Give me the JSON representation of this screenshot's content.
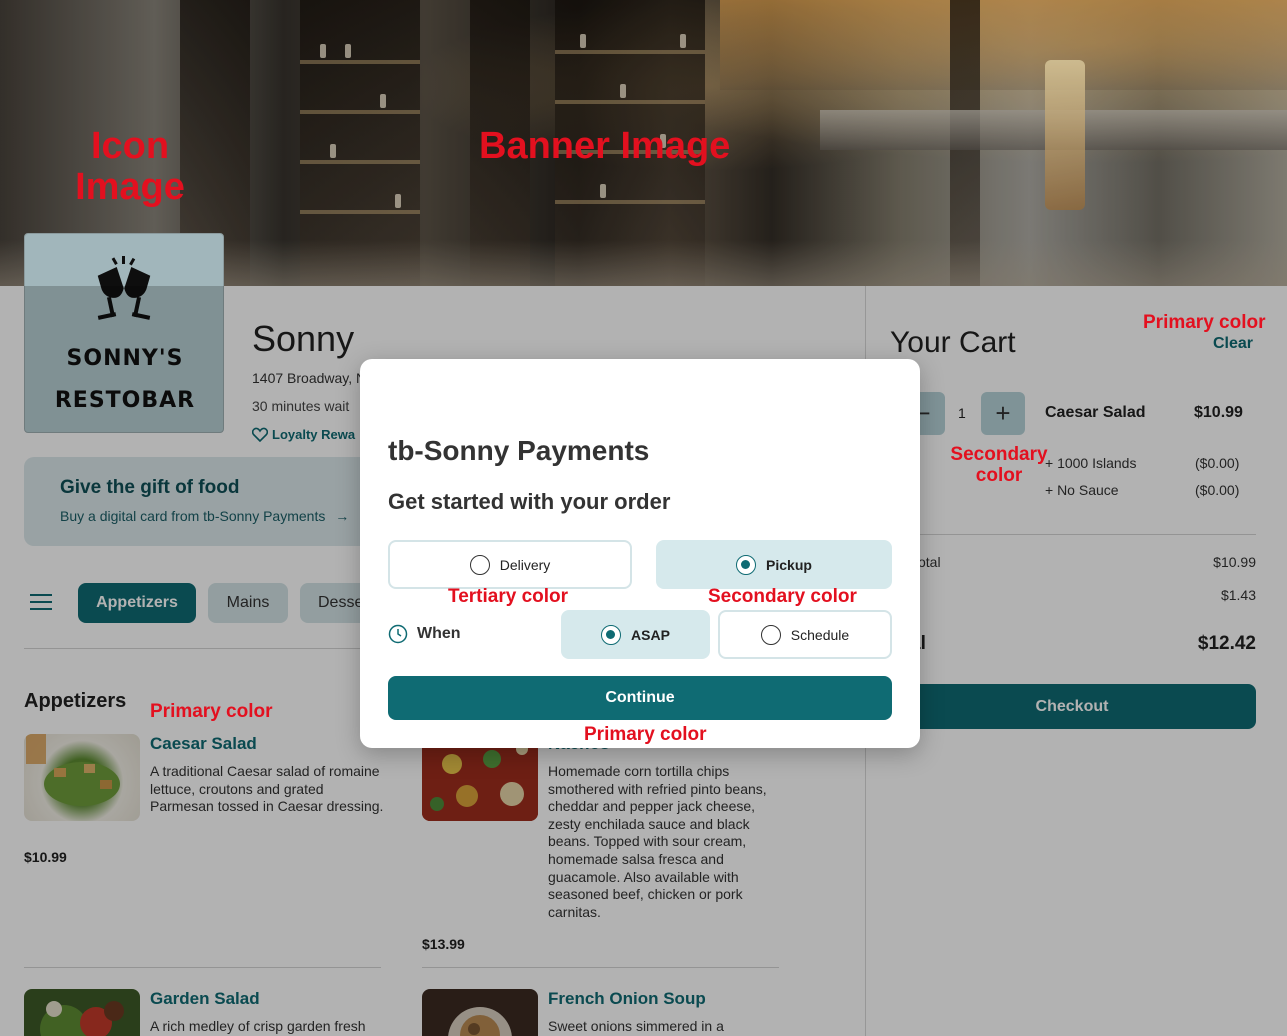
{
  "banner": {
    "annotation_banner": "Banner Image",
    "annotation_icon_line1": "Icon",
    "annotation_icon_line2": "Image"
  },
  "restaurant": {
    "logo_line1": "SONNY'S",
    "logo_line2": "RESTOBAR",
    "name": "Sonny",
    "address": "1407 Broadway, N",
    "wait": "30 minutes wait",
    "loyalty": "Loyalty Rewa"
  },
  "gift": {
    "title": "Give the gift of food",
    "subtitle": "Buy a digital card from tb-Sonny Payments",
    "arrow": "→"
  },
  "tabs": [
    {
      "label": "Appetizers",
      "active": true
    },
    {
      "label": "Mains",
      "active": false
    },
    {
      "label": "Desse",
      "active": false
    }
  ],
  "menu": {
    "section_title": "Appetizers",
    "items": [
      {
        "name": "Caesar Salad",
        "desc": "A traditional Caesar salad of romaine lettuce, croutons and grated Parmesan tossed in Caesar dressing.",
        "price": "$10.99"
      },
      {
        "name": "Nachos",
        "desc": "Homemade corn tortilla chips smothered with refried pinto beans, cheddar and pepper jack cheese, zesty enchilada sauce and black beans. Topped with sour cream, homemade salsa fresca and guacamole. Also available with seasoned beef, chicken or pork carnitas.",
        "price": "$13.99"
      },
      {
        "name": "Garden Salad",
        "desc": "A rich medley of crisp garden fresh",
        "price": ""
      },
      {
        "name": "French Onion Soup",
        "desc": "Sweet onions simmered in a",
        "price": ""
      }
    ]
  },
  "cart": {
    "title": "Your Cart",
    "clear": "Clear",
    "minus": "−",
    "plus": "+",
    "qty": "1",
    "item_name": "Caesar Salad",
    "item_price": "$10.99",
    "mods": [
      {
        "name": "+ 1000 Islands",
        "price": "($0.00)"
      },
      {
        "name": "+ No Sauce",
        "price": "($0.00)"
      }
    ],
    "subtotal_label": "otal",
    "subtotal_value": "$10.99",
    "tax_value": "$1.43",
    "total_label": "al",
    "total_value": "$12.42",
    "checkout": "Checkout"
  },
  "modal": {
    "title": "tb-Sonny Payments",
    "subtitle": "Get started with your order",
    "delivery": "Delivery",
    "pickup": "Pickup",
    "when": "When",
    "asap": "ASAP",
    "schedule": "Schedule",
    "continue": "Continue",
    "selected_mode": "Pickup",
    "selected_time": "ASAP"
  },
  "annotations": {
    "primary_color": "Primary color",
    "secondary_color_line1": "Secondary",
    "secondary_color_line2": "color",
    "secondary_color": "Secondary color",
    "tertiary_color": "Tertiary color"
  },
  "colors": {
    "primary": "#0f6b73",
    "secondary": "#d6e9ec",
    "tertiary": "#ffffff",
    "annotation": "#e3101f"
  }
}
